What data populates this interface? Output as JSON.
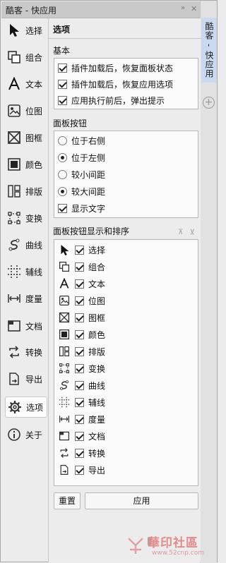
{
  "window": {
    "title": "酷客 - 快应用",
    "pin_icon": "double-chevron-right-icon",
    "close_icon": "close-icon"
  },
  "rail": {
    "tab_label": "酷客 - 快应用",
    "add_icon": "plus-circle-icon"
  },
  "sidebar": {
    "items": [
      {
        "label": "选择",
        "icon": "cursor-arrow-icon"
      },
      {
        "label": "组合",
        "icon": "group-squares-icon"
      },
      {
        "label": "文本",
        "icon": "text-a-icon"
      },
      {
        "label": "位图",
        "icon": "image-icon"
      },
      {
        "label": "图框",
        "icon": "frame-x-icon"
      },
      {
        "label": "颜色",
        "icon": "color-square-icon"
      },
      {
        "label": "排版",
        "icon": "layout-icon"
      },
      {
        "label": "变换",
        "icon": "transform-icon"
      },
      {
        "label": "曲线",
        "icon": "curve-icon"
      },
      {
        "label": "辅线",
        "icon": "guides-icon"
      },
      {
        "label": "度量",
        "icon": "measure-icon"
      },
      {
        "label": "文档",
        "icon": "document-icon"
      },
      {
        "label": "转换",
        "icon": "convert-icon"
      },
      {
        "label": "导出",
        "icon": "export-icon"
      },
      {
        "label": "选项",
        "icon": "gear-icon",
        "active": true
      },
      {
        "label": "关于",
        "icon": "info-icon"
      }
    ]
  },
  "panel": {
    "title": "选项",
    "basic": {
      "heading": "基本",
      "options": [
        {
          "label": "插件加载后，恢复面板状态",
          "checked": true
        },
        {
          "label": "插件加载后，恢复应用选项",
          "checked": true
        },
        {
          "label": "应用执行前后，弹出提示",
          "checked": true
        }
      ]
    },
    "buttons": {
      "heading": "面板按钮",
      "radios": [
        {
          "label": "位于右侧",
          "selected": false
        },
        {
          "label": "位于左侧",
          "selected": true
        },
        {
          "label": "较小间距",
          "selected": false
        },
        {
          "label": "较大间距",
          "selected": true
        }
      ],
      "show_text": {
        "label": "显示文字",
        "checked": true
      }
    },
    "order": {
      "heading": "面板按钮显示和排序",
      "sort_icons": [
        "move-up-icon",
        "move-down-icon"
      ],
      "items": [
        {
          "label": "选择",
          "checked": true
        },
        {
          "label": "组合",
          "checked": true
        },
        {
          "label": "文本",
          "checked": true
        },
        {
          "label": "位图",
          "checked": true
        },
        {
          "label": "图框",
          "checked": true
        },
        {
          "label": "颜色",
          "checked": true
        },
        {
          "label": "排版",
          "checked": true
        },
        {
          "label": "变换",
          "checked": true
        },
        {
          "label": "曲线",
          "checked": true
        },
        {
          "label": "辅线",
          "checked": true
        },
        {
          "label": "度量",
          "checked": true
        },
        {
          "label": "文档",
          "checked": true
        },
        {
          "label": "转换",
          "checked": true
        },
        {
          "label": "导出",
          "checked": true
        }
      ]
    },
    "reset_label": "重置",
    "apply_label": "应用"
  },
  "watermark": {
    "text": "華印社區",
    "url": "www.52cnp.com"
  }
}
